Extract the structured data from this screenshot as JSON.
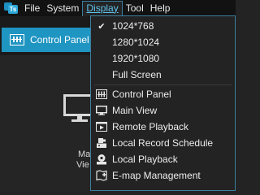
{
  "menubar": {
    "logo_icon": "app-logo-icon",
    "items": [
      {
        "label": "File"
      },
      {
        "label": "System"
      },
      {
        "label": "Display"
      },
      {
        "label": "Tool"
      },
      {
        "label": "Help"
      }
    ],
    "active_item": "Display"
  },
  "background": {
    "active_tab": {
      "label": "Control Panel",
      "icon": "control-panel-icon"
    },
    "tile": {
      "label_line1": "Ma",
      "label_line2": "Vie",
      "icon": "monitor-icon"
    }
  },
  "display_menu": {
    "resolutions": [
      {
        "label": "1024*768",
        "checked": true
      },
      {
        "label": "1280*1024",
        "checked": false
      },
      {
        "label": "1920*1080",
        "checked": false
      },
      {
        "label": "Full Screen",
        "checked": false
      }
    ],
    "views": [
      {
        "label": "Control Panel",
        "icon": "control-panel-icon"
      },
      {
        "label": "Main View",
        "icon": "monitor-icon"
      },
      {
        "label": "Remote Playback",
        "icon": "remote-playback-icon"
      },
      {
        "label": "Local Record Schedule",
        "icon": "record-schedule-icon"
      },
      {
        "label": "Local Playback",
        "icon": "local-playback-icon"
      },
      {
        "label": "E-map Management",
        "icon": "emap-icon"
      }
    ]
  },
  "colors": {
    "accent": "#1f95c2",
    "active_menu_text": "#5fc3ee",
    "menu_background": "#232323"
  }
}
